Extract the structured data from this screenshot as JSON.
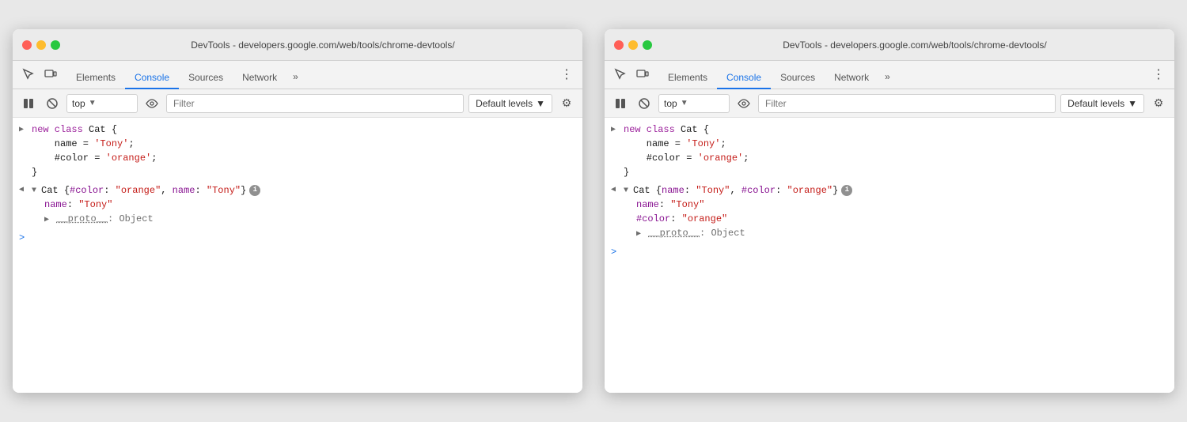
{
  "windows": [
    {
      "id": "window-left",
      "title": "DevTools - developers.google.com/web/tools/chrome-devtools/",
      "tabs": {
        "items": [
          {
            "id": "elements",
            "label": "Elements",
            "active": false
          },
          {
            "id": "console",
            "label": "Console",
            "active": true
          },
          {
            "id": "sources",
            "label": "Sources",
            "active": false
          },
          {
            "id": "network",
            "label": "Network",
            "active": false
          },
          {
            "id": "more",
            "label": "»",
            "active": false
          }
        ]
      },
      "toolbar": {
        "context": "top",
        "filter_placeholder": "Filter",
        "levels_label": "Default levels",
        "play_icon": "▶",
        "block_icon": "⊘",
        "eye_icon": "👁",
        "dropdown_icon": "▼",
        "gear_icon": "⚙"
      },
      "console": {
        "entries": [
          {
            "type": "input",
            "lines": [
              "new class Cat {",
              "    name = 'Tony';",
              "    #color = 'orange';",
              "}"
            ]
          },
          {
            "type": "output",
            "obj_header": "▼Cat {#color: ",
            "obj_color": "\"orange\"",
            "obj_middle": ", name: ",
            "obj_name": "\"Tony\"",
            "obj_end": "}",
            "has_info": true,
            "prop1_key": "name",
            "prop1_val": "\"Tony\"",
            "proto_label": "▶ __proto__",
            "proto_val": ": Object"
          }
        ],
        "prompt": ">"
      }
    },
    {
      "id": "window-right",
      "title": "DevTools - developers.google.com/web/tools/chrome-devtools/",
      "tabs": {
        "items": [
          {
            "id": "elements",
            "label": "Elements",
            "active": false
          },
          {
            "id": "console",
            "label": "Console",
            "active": true
          },
          {
            "id": "sources",
            "label": "Sources",
            "active": false
          },
          {
            "id": "network",
            "label": "Network",
            "active": false
          },
          {
            "id": "more",
            "label": "»",
            "active": false
          }
        ]
      },
      "toolbar": {
        "context": "top",
        "filter_placeholder": "Filter",
        "levels_label": "Default levels",
        "play_icon": "▶",
        "block_icon": "⊘",
        "eye_icon": "👁",
        "dropdown_icon": "▼",
        "gear_icon": "⚙"
      },
      "console": {
        "entries": [
          {
            "type": "input",
            "lines": [
              "new class Cat {",
              "    name = 'Tony';",
              "    #color = 'orange';",
              "}"
            ]
          },
          {
            "type": "output",
            "obj_header": "▼Cat {name: ",
            "obj_name": "\"Tony\"",
            "obj_middle": ", #color: ",
            "obj_color": "\"orange\"",
            "obj_end": "}",
            "has_info": true,
            "prop1_key": "name",
            "prop1_val": "\"Tony\"",
            "prop2_key": "#color",
            "prop2_val": "\"orange\"",
            "proto_label": "▶ __proto__",
            "proto_val": ": Object"
          }
        ],
        "prompt": ">"
      }
    }
  ]
}
